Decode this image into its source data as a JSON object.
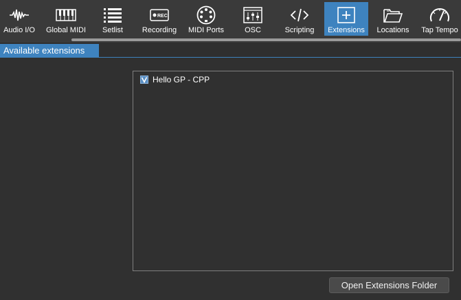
{
  "toolbar": {
    "items": [
      {
        "label": "Audio I/O",
        "icon": "waveform-icon"
      },
      {
        "label": "Global MIDI",
        "icon": "piano-keyboard-icon"
      },
      {
        "label": "Setlist",
        "icon": "list-icon"
      },
      {
        "label": "Recording",
        "icon": "rec-icon"
      },
      {
        "label": "MIDI Ports",
        "icon": "midi-din-icon"
      },
      {
        "label": "OSC",
        "icon": "mixer-panel-icon"
      },
      {
        "label": "Scripting",
        "icon": "code-icon"
      },
      {
        "label": "Extensions",
        "icon": "plus-square-icon"
      },
      {
        "label": "Locations",
        "icon": "folder-icon"
      },
      {
        "label": "Tap Tempo",
        "icon": "gauge-icon"
      }
    ],
    "active": "Extensions",
    "rec_badge": "REC"
  },
  "tabs": [
    {
      "label": "Available extensions"
    }
  ],
  "extensions": {
    "items": [
      {
        "name": "Hello GP - CPP",
        "checked": true
      }
    ]
  },
  "open_folder_button": "Open Extensions Folder",
  "colors": {
    "accent": "#3e83bf",
    "background": "#303030",
    "toolbar": "#3a3a3a",
    "button": "#4a4a4a"
  }
}
